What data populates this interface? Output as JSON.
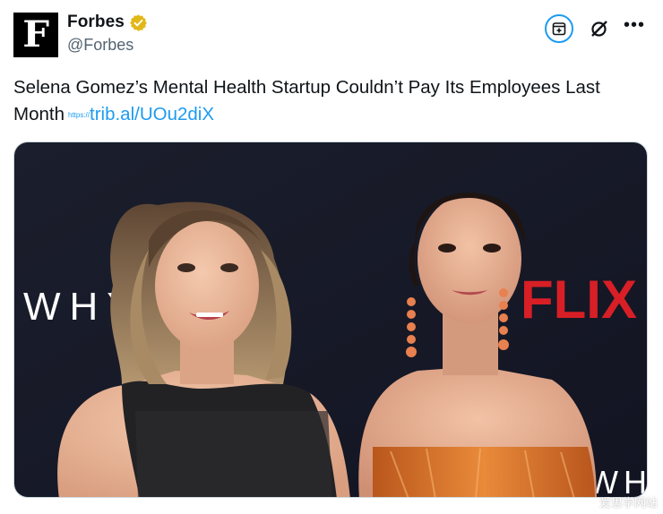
{
  "account": {
    "display_name": "Forbes",
    "handle": "@Forbes",
    "avatar_letter": "F",
    "verified_color": "#e2b719"
  },
  "actions": {
    "subscribe_icon": "add-to-list-icon",
    "grok_icon": "grok-icon",
    "more_label": "•••"
  },
  "tweet": {
    "text": "Selena Gomez’s Mental Health Startup Couldn’t Pay Its Employees Last Month",
    "link_prefix": "https://",
    "link_text": "trib.al/UOu2diX"
  },
  "media": {
    "backdrop_text_left": "WHY",
    "backdrop_text_right": "FLIX",
    "backdrop_text_bottom": "WH"
  },
  "watermark": "爱思学网站",
  "colors": {
    "link": "#1d9bf0",
    "secondary_text": "#536471",
    "netflix_red": "#d81f26"
  }
}
